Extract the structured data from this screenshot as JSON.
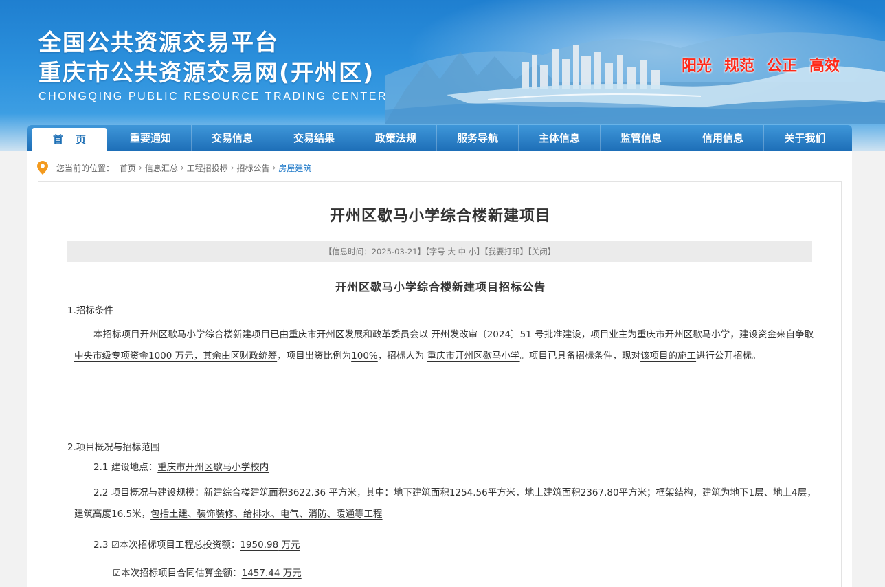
{
  "header": {
    "title_line1": "全国公共资源交易平台",
    "title_line2": "重庆市公共资源交易网(开州区)",
    "title_en": "CHONGQING PUBLIC RESOURCE TRADING CENTER",
    "slogans": [
      "阳光",
      "规范",
      "公正",
      "高效"
    ]
  },
  "nav": {
    "items": [
      "首页",
      "重要通知",
      "交易信息",
      "交易结果",
      "政策法规",
      "服务导航",
      "主体信息",
      "监管信息",
      "信用信息",
      "关于我们"
    ]
  },
  "breadcrumb": {
    "prefix": "您当前的位置：",
    "items": [
      "首页",
      "信息汇总",
      "工程招投标",
      "招标公告",
      "房屋建筑"
    ]
  },
  "article": {
    "title": "开州区歇马小学综合楼新建项目",
    "meta": {
      "time_label": "【信息时间：2025-03-21】",
      "font_label": "【字号",
      "font_big": "大",
      "font_mid": "中",
      "font_small": "小",
      "font_end": "】",
      "print": "【我要打印】",
      "close": "【关闭】"
    },
    "notice_title": "开州区歇马小学综合楼新建项目招标公告",
    "s1_heading": "1.招标条件",
    "s1": {
      "t1": "本招标项目",
      "project": "开州区歇马小学综合楼新建项目",
      "t2": "已由",
      "approver": "重庆市开州区发展和政革委员会",
      "t3": "以",
      "approval_no": "  开州发改审〔2024〕51 ",
      "t4": "号批准建设，项目业主为",
      "owner": "重庆市开州区歇马小学",
      "t5": "，建设资金来自",
      "funds": "争取中央市级专项资金1000 万元，其余由区财政统筹",
      "t6": "，项目出资比例为",
      "ratio": "100%",
      "t7": "，招标人为 ",
      "tenderer": "重庆市开州区歇马小学",
      "t8": "。项目已具备招标条件，现对",
      "scope": "该项目的施工",
      "t9": "进行公开招标。"
    },
    "s2_heading": "2.项目概况与招标范围",
    "s2_1": {
      "label": "2.1  建设地点：",
      "value": "重庆市开州区歇马小学校内"
    },
    "s2_2": {
      "label": "2.2  项目概况与建设规模：",
      "v1": "新建综合楼建筑面积3622.36  平方米，其中：",
      "v2": "地下建筑面积1254.56",
      "v3": "平方米，",
      "v4": "地上建筑面积2367.80",
      "v5": "平方米；",
      "v6": "框架结构，建筑为地下1",
      "v7": "层、地上4",
      "v8": "层，建筑高度16.5",
      "v9": "米，",
      "v10": "包括土建、装饰装修、给排水、电气、消防、暖通等工程"
    },
    "s2_3": {
      "label": "2.3  ",
      "check1": "☑本次招标项目工程总投资额：",
      "invest": "1950.98",
      "unit1": " 万元",
      "check2": "☑本次招标项目合同估算金额：",
      "contract": "1457.44",
      "unit2": " 万元"
    }
  },
  "colors": {
    "nav_blue": "#1e6fb8",
    "slogan_red": "#ff2a1a",
    "crumb_active": "#1f79c8"
  }
}
